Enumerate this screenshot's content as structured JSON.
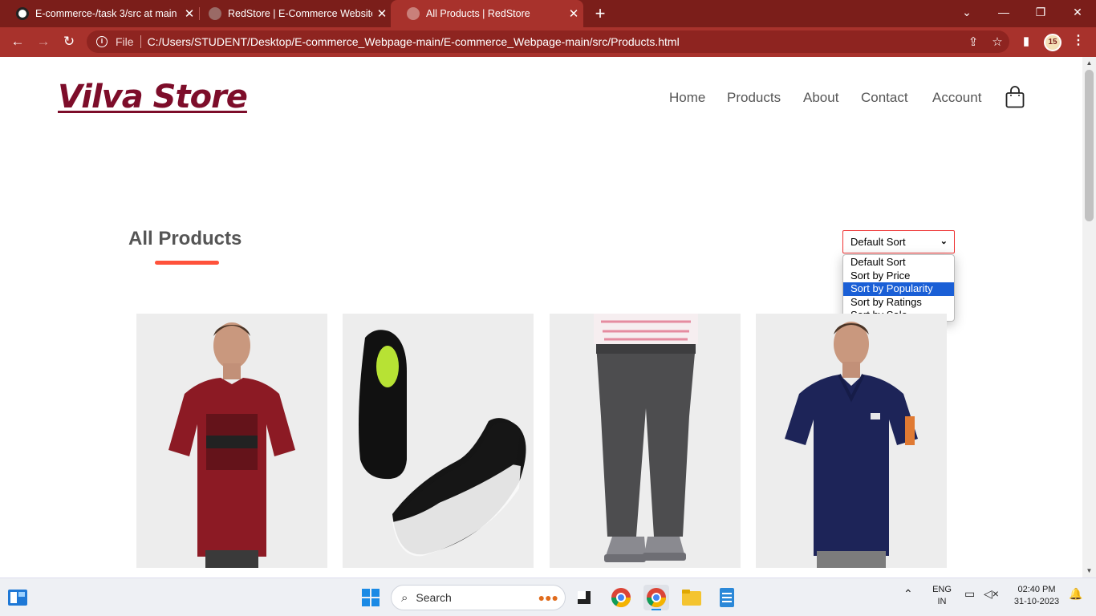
{
  "browser": {
    "tabs": [
      {
        "title": "E-commerce-/task 3/src at main",
        "active": false
      },
      {
        "title": "RedStore | E-Commerce Website",
        "active": false
      },
      {
        "title": "All Products | RedStore",
        "active": true
      }
    ],
    "address": {
      "scheme_label": "File",
      "url": "C:/Users/STUDENT/Desktop/E-commerce_Webpage-main/E-commerce_Webpage-main/src/Products.html"
    },
    "profile_badge": "15"
  },
  "site": {
    "logo": "Vilva Store",
    "nav": [
      "Home",
      "Products",
      "About",
      "Contact",
      "Account"
    ],
    "page_title": "All Products",
    "sort": {
      "selected": "Default Sort",
      "options": [
        "Default Sort",
        "Sort by Price",
        "Sort by Popularity",
        "Sort by Ratings",
        "Sort by Sale"
      ],
      "highlighted": "Sort by Popularity"
    },
    "products": [
      {
        "name": "maroon-tshirt"
      },
      {
        "name": "black-sneakers"
      },
      {
        "name": "grey-joggers"
      },
      {
        "name": "navy-polo"
      }
    ]
  },
  "taskbar": {
    "search_placeholder": "Search",
    "language": "ENG",
    "region": "IN",
    "time": "02:40 PM",
    "date": "31-10-2023"
  },
  "colors": {
    "chrome": "#7b1e1a",
    "toolbar": "#a8322c",
    "logo": "#7d0d2a",
    "accent": "#ff523b",
    "highlight": "#1a5fd6"
  }
}
